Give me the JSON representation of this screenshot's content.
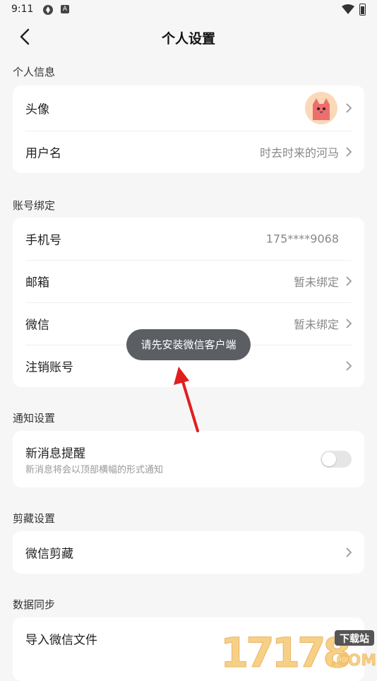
{
  "status": {
    "time": "9:11",
    "icon_a": "A"
  },
  "header": {
    "title": "个人设置"
  },
  "sections": {
    "personal": {
      "title": "个人信息",
      "avatar_label": "头像",
      "username_label": "用户名",
      "username_value": "时去时来的河马"
    },
    "account": {
      "title": "账号绑定",
      "phone_label": "手机号",
      "phone_value": "175****9068",
      "email_label": "邮箱",
      "email_value": "暂未绑定",
      "wechat_label": "微信",
      "wechat_value": "暂未绑定",
      "cancel_label": "注销账号"
    },
    "notify": {
      "title": "通知设置",
      "new_msg_label": "新消息提醒",
      "new_msg_desc": "新消息将会以顶部横幅的形式通知",
      "toggle_on": false
    },
    "clip": {
      "title": "剪藏设置",
      "wechat_clip_label": "微信剪藏"
    },
    "sync": {
      "title": "数据同步",
      "import_label": "导入微信文件"
    }
  },
  "toast": {
    "text": "请先安装微信客户端"
  },
  "watermark": {
    "digits": "17178",
    "badge": "下载站",
    "suffix": ".COM"
  },
  "colors": {
    "toast_bg": "#5b5e63",
    "arrow": "#e01f1f",
    "background": "#f6f6f6"
  }
}
